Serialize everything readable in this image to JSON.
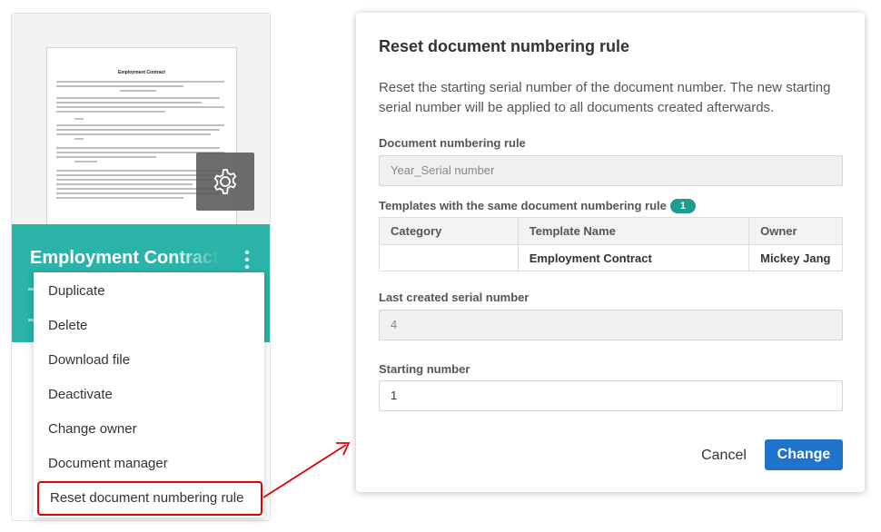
{
  "card": {
    "thumbnail": {
      "doc_title": "Employment Contract",
      "gear_icon": "gear-icon"
    },
    "title": "Employment Contract",
    "more_icon": "kebab-vertical-icon"
  },
  "menu": {
    "items": [
      {
        "label": "Duplicate"
      },
      {
        "label": "Delete"
      },
      {
        "label": "Download file"
      },
      {
        "label": "Deactivate"
      },
      {
        "label": "Change owner"
      },
      {
        "label": "Document manager"
      },
      {
        "label": "Reset document numbering rule"
      }
    ],
    "highlight_color": "#e10000"
  },
  "dialog": {
    "title": "Reset document numbering rule",
    "description": "Reset the starting serial number of the document number. The new starting serial number will be applied to all documents created afterwards.",
    "rule_label": "Document numbering rule",
    "rule_value": "Year_Serial number",
    "templates_label": "Templates with the same document numbering rule",
    "templates_count": "1",
    "table": {
      "headers": [
        "Category",
        "Template Name",
        "Owner"
      ],
      "rows": [
        [
          "",
          "Employment Contract",
          "Mickey Jang"
        ]
      ]
    },
    "last_serial_label": "Last created serial number",
    "last_serial_value": "4",
    "starting_label": "Starting number",
    "starting_value": "1",
    "cancel_label": "Cancel",
    "change_label": "Change"
  },
  "colors": {
    "teal": "#2ab3a8",
    "badge": "#1d9d8f",
    "primary_button": "#1f73c9"
  }
}
